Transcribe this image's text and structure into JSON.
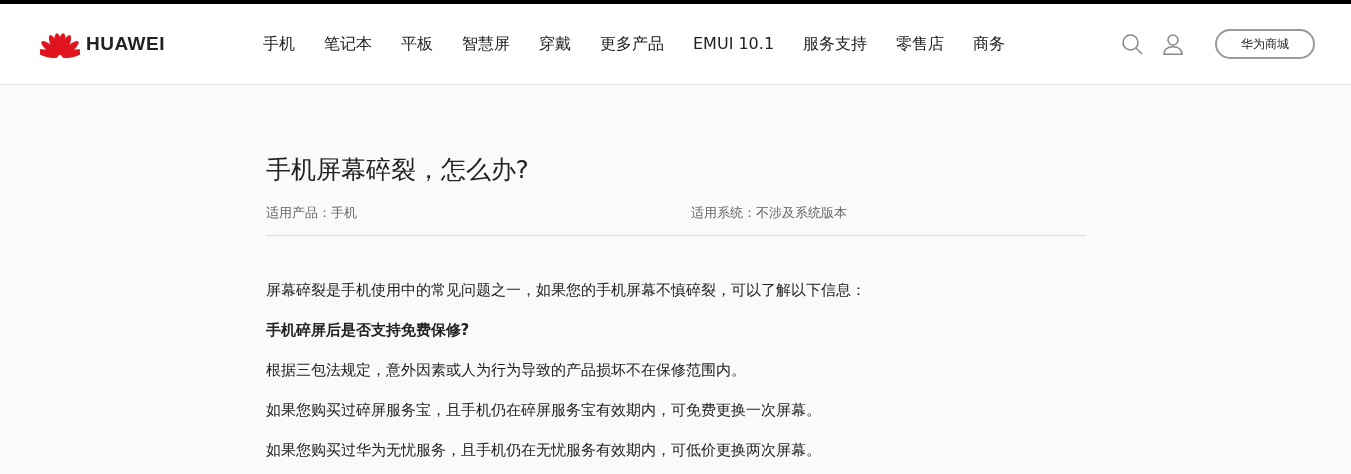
{
  "header": {
    "logo": {
      "text": "HUAWEI"
    },
    "nav": [
      {
        "label": "手机"
      },
      {
        "label": "笔记本"
      },
      {
        "label": "平板"
      },
      {
        "label": "智慧屏"
      },
      {
        "label": "穿戴"
      },
      {
        "label": "更多产品"
      },
      {
        "label": "EMUI 10.1"
      },
      {
        "label": "服务支持"
      },
      {
        "label": "零售店"
      },
      {
        "label": "商务"
      }
    ],
    "store_button": "华为商城"
  },
  "article": {
    "title": "手机屏幕碎裂，怎么办?",
    "meta": [
      "适用产品：手机",
      "适用系统：不涉及系统版本"
    ],
    "paragraphs": [
      {
        "kind": "text",
        "text": "屏幕碎裂是手机使用中的常见问题之一，如果您的手机屏幕不慎碎裂，可以了解以下信息："
      },
      {
        "kind": "heading",
        "text": "手机碎屏后是否支持免费保修?"
      },
      {
        "kind": "text",
        "text": "根据三包法规定，意外因素或人为行为导致的产品损坏不在保修范围内。"
      },
      {
        "kind": "text",
        "text": "如果您购买过碎屏服务宝，且手机仍在碎屏服务宝有效期内，可免费更换一次屏幕。"
      },
      {
        "kind": "text",
        "text": "如果您购买过华为无忧服务，且手机仍在无忧服务有效期内，可低价更换两次屏幕。"
      }
    ]
  }
}
